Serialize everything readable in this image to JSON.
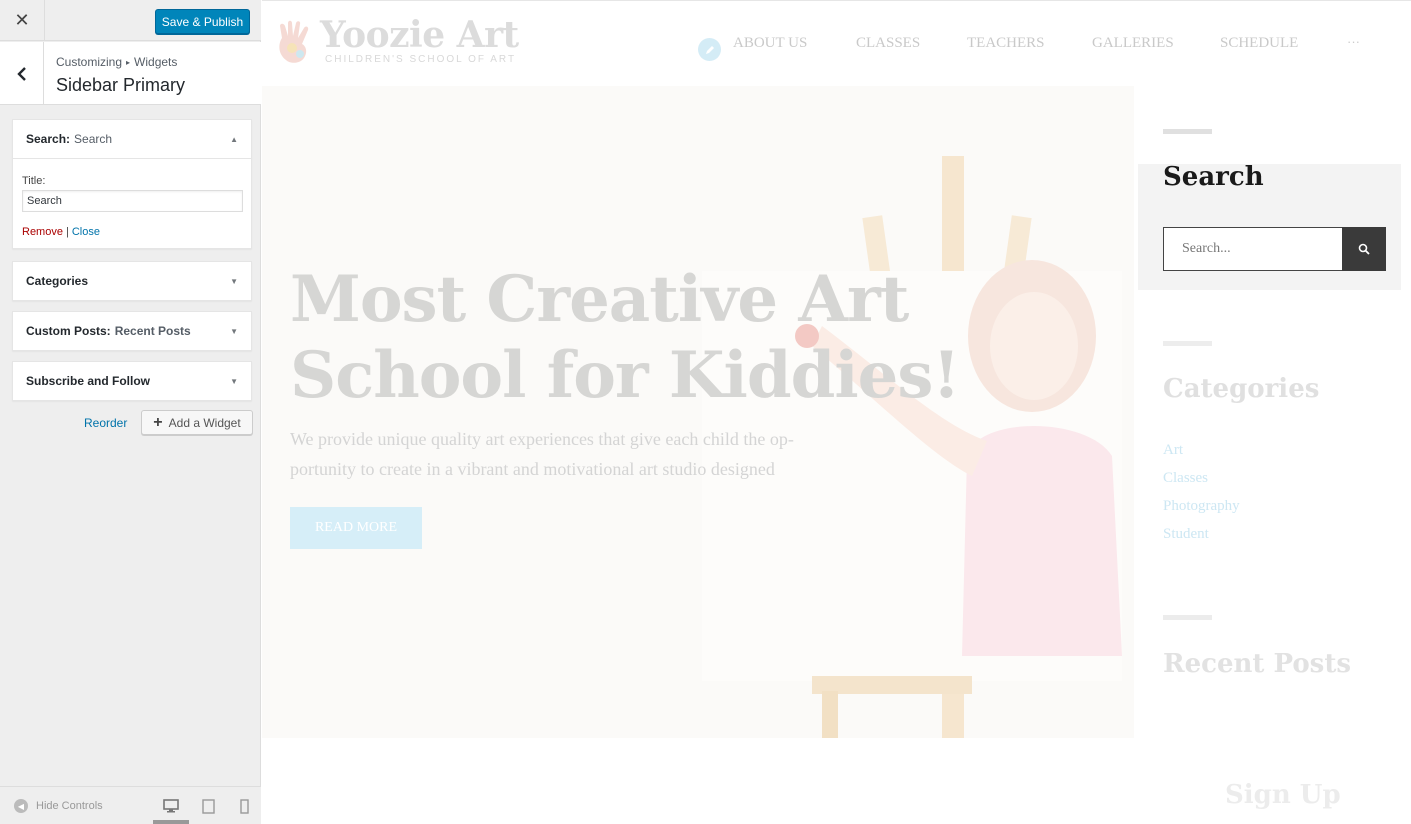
{
  "customizer": {
    "close_label": "✕",
    "publish_label": "Save & Publish",
    "breadcrumb": {
      "root": "Customizing",
      "sep": "▸",
      "section": "Widgets"
    },
    "panel_title": "Sidebar Primary",
    "widgets": [
      {
        "name": "Search:",
        "subtitle": "Search",
        "expanded": true
      },
      {
        "name": "Categories",
        "subtitle": "",
        "expanded": false
      },
      {
        "name": "Custom Posts:",
        "subtitle": "Recent Posts",
        "expanded": false
      },
      {
        "name": "Subscribe and Follow",
        "subtitle": "",
        "expanded": false
      }
    ],
    "search_form": {
      "title_label": "Title:",
      "title_value": "Search",
      "remove_label": "Remove",
      "sep": "|",
      "close_label": "Close"
    },
    "reorder_label": "Reorder",
    "add_widget_label": "Add a Widget",
    "hide_controls_label": "Hide Controls"
  },
  "preview": {
    "logo": {
      "name": "Yoozie Art",
      "tagline": "CHILDREN'S SCHOOL OF ART"
    },
    "nav": [
      "ABOUT US",
      "CLASSES",
      "TEACHERS",
      "GALLERIES",
      "SCHEDULE"
    ],
    "nav_more": "···",
    "hero": {
      "headline_1": "Most Creative Art",
      "headline_2": "School for Kiddies!",
      "text_1": "We provide unique quality art experiences that give each child the op-",
      "text_2": "portunity to create in a vibrant and motivational art studio designed",
      "button": "READ MORE"
    },
    "sidebar": {
      "search_title": "Search",
      "search_placeholder": "Search...",
      "categories_title": "Categories",
      "categories": [
        "Art",
        "Classes",
        "Photography",
        "Student"
      ],
      "recent_title": "Recent Posts",
      "signup_title": "Sign Up"
    }
  },
  "colors": {
    "publish": "#0085ba",
    "link": "#0073aa",
    "remove": "#aa0000",
    "search_button": "#3a3a3a"
  }
}
